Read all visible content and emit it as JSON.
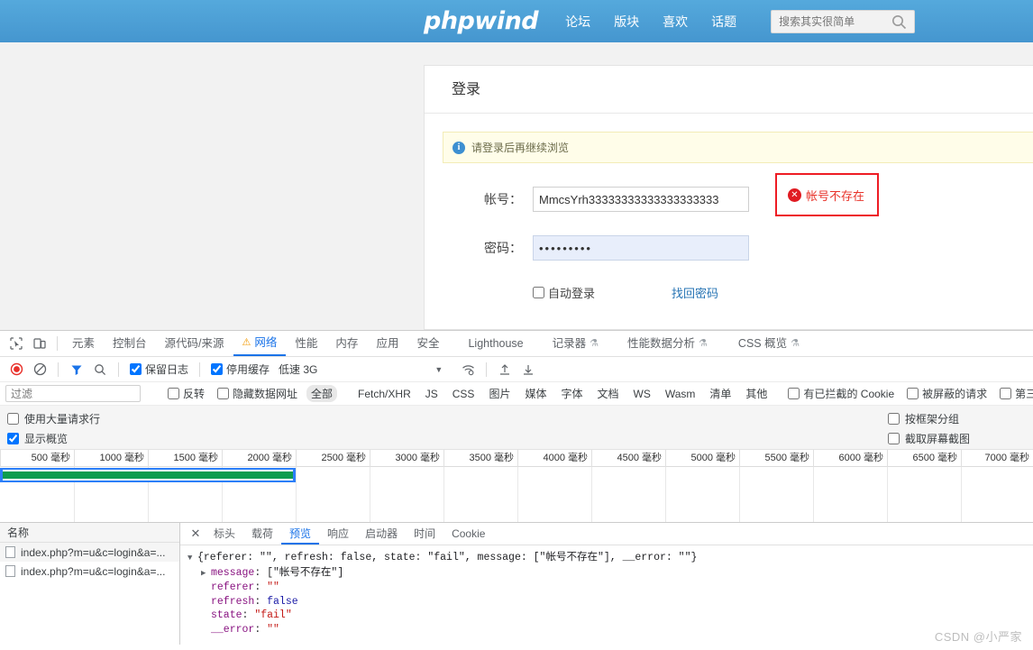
{
  "site": {
    "logo": "phpwind",
    "nav": [
      "论坛",
      "版块",
      "喜欢",
      "话题"
    ],
    "search_placeholder": "搜索其实很简单",
    "search_value": ""
  },
  "login": {
    "title": "登录",
    "notice": "请登录后再继续浏览",
    "account_label": "帐号：",
    "account_value": "MmcsYrh33333333333333333333",
    "password_label": "密码：",
    "password_value": "•••••••••",
    "error_text": "帐号不存在",
    "auto_login_label": "自动登录",
    "auto_login_checked": false,
    "find_password_label": "找回密码"
  },
  "devtools": {
    "panels": [
      {
        "label": "元素",
        "active": false,
        "icon": null
      },
      {
        "label": "控制台",
        "active": false,
        "icon": null
      },
      {
        "label": "源代码/来源",
        "active": false,
        "icon": null
      },
      {
        "label": "网络",
        "active": true,
        "icon": "warning-icon"
      },
      {
        "label": "性能",
        "active": false,
        "icon": null
      },
      {
        "label": "内存",
        "active": false,
        "icon": null
      },
      {
        "label": "应用",
        "active": false,
        "icon": null
      },
      {
        "label": "安全",
        "active": false,
        "icon": null
      },
      {
        "label": "Lighthouse",
        "active": false,
        "icon": null
      },
      {
        "label": "记录器",
        "active": false,
        "icon": "beaker-icon"
      },
      {
        "label": "性能数据分析",
        "active": false,
        "icon": "beaker-icon"
      },
      {
        "label": "CSS 概览",
        "active": false,
        "icon": "beaker-icon"
      }
    ],
    "toolbar": {
      "record_title": "record-button",
      "clear_title": "clear-button",
      "filter_title": "filter-button",
      "search_title": "search-button",
      "preserve_log_label": "保留日志",
      "preserve_log_checked": true,
      "disable_cache_label": "停用缓存",
      "disable_cache_checked": true,
      "throttle_value": "低速 3G",
      "import_title": "import-har",
      "export_title": "export-har"
    },
    "filterbar": {
      "filter_placeholder": "过滤",
      "filter_value": "",
      "invert_label": "反转",
      "invert_checked": false,
      "hide_data_urls_label": "隐藏数据网址",
      "hide_data_urls_checked": false,
      "types": [
        "全部",
        "Fetch/XHR",
        "JS",
        "CSS",
        "图片",
        "媒体",
        "字体",
        "文档",
        "WS",
        "Wasm",
        "清单",
        "其他"
      ],
      "selected_type": "全部",
      "blocked_cookies_label": "有已拦截的 Cookie",
      "blocked_cookies_checked": false,
      "blocked_requests_label": "被屏蔽的请求",
      "blocked_requests_checked": false,
      "third_party_label": "第三方请求",
      "third_party_checked": false
    },
    "options": {
      "big_request_rows_label": "使用大量请求行",
      "big_request_rows_checked": false,
      "show_overview_label": "显示概览",
      "show_overview_checked": true,
      "group_by_frame_label": "按框架分组",
      "group_by_frame_checked": false,
      "capture_screenshots_label": "截取屏幕截图",
      "capture_screenshots_checked": false
    },
    "overview": {
      "ticks": [
        "500 毫秒",
        "1000 毫秒",
        "1500 毫秒",
        "2000 毫秒",
        "2500 毫秒",
        "3000 毫秒",
        "3500 毫秒",
        "4000 毫秒",
        "4500 毫秒",
        "5000 毫秒",
        "5500 毫秒",
        "6000 毫秒",
        "6500 毫秒",
        "7000 毫秒"
      ],
      "selection_color": "#2d7ff9",
      "bar_color": "#0d9d4f"
    },
    "requests": {
      "column_header": "名称",
      "rows": [
        {
          "name": "index.php?m=u&c=login&a=..."
        },
        {
          "name": "index.php?m=u&c=login&a=..."
        }
      ]
    },
    "detail": {
      "tabs": [
        "标头",
        "载荷",
        "预览",
        "响应",
        "启动器",
        "时间",
        "Cookie"
      ],
      "active_tab": "预览",
      "preview": {
        "summary_prefix": "{referer: ",
        "lines": [
          {
            "indent": 0,
            "arrow": "▼",
            "raw": "{referer: \"\", refresh: false, state: \"fail\", message: [\"帐号不存在\"], __error: \"\"}"
          },
          {
            "indent": 1,
            "arrow": "▶",
            "key": "message",
            "value": "[\"帐号不存在\"]"
          },
          {
            "indent": 1,
            "arrow": "",
            "key": "referer",
            "value": "\"\""
          },
          {
            "indent": 1,
            "arrow": "",
            "key": "refresh",
            "value": "false"
          },
          {
            "indent": 1,
            "arrow": "",
            "key": "state",
            "value": "\"fail\""
          },
          {
            "indent": 1,
            "arrow": "",
            "key": "__error",
            "value": "\"\""
          }
        ]
      }
    }
  },
  "watermark": "CSDN @小严家"
}
